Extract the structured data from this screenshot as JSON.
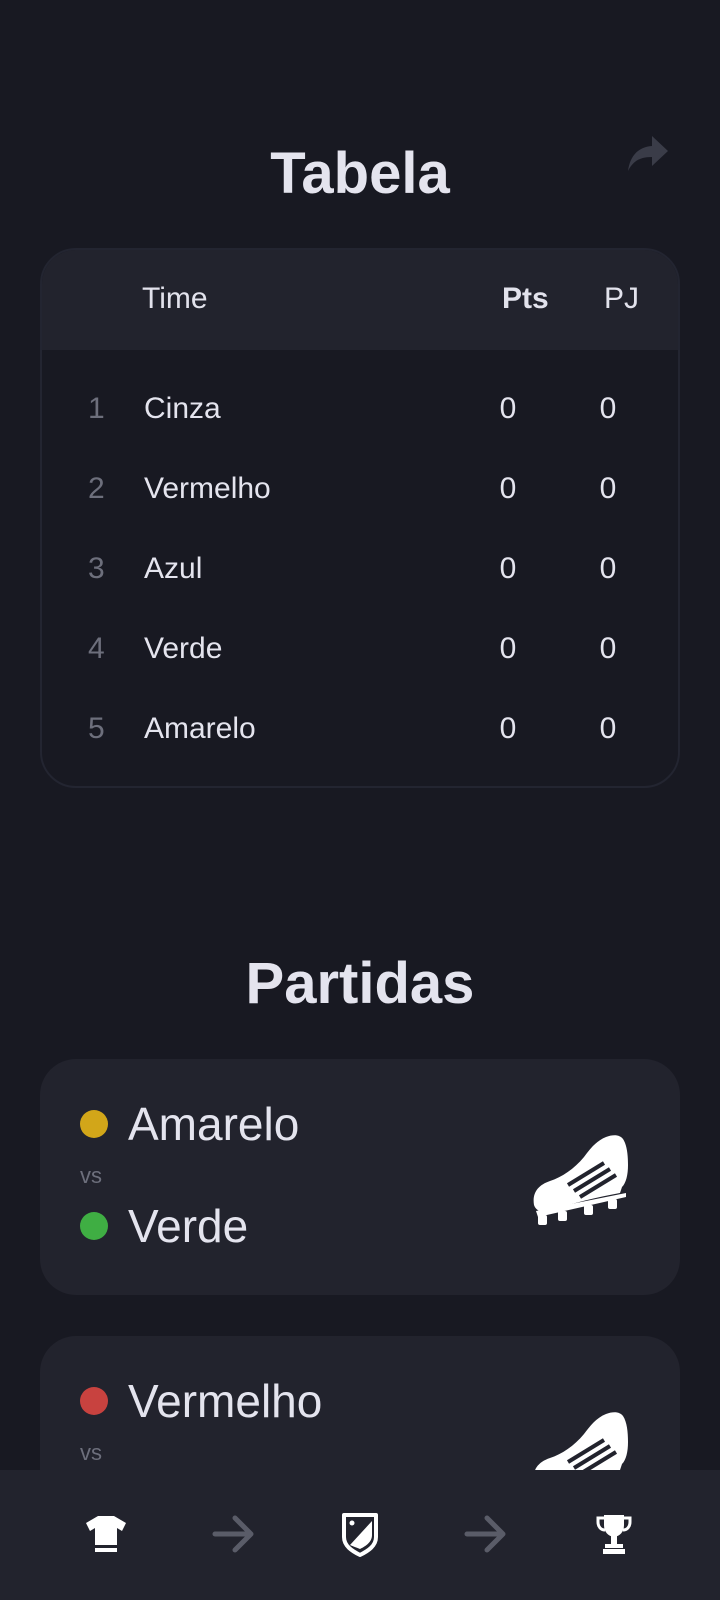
{
  "standings": {
    "title": "Tabela",
    "headers": {
      "team": "Time",
      "points": "Pts",
      "played": "PJ"
    },
    "rows": [
      {
        "pos": "1",
        "team": "Cinza",
        "points": "0",
        "played": "0"
      },
      {
        "pos": "2",
        "team": "Vermelho",
        "points": "0",
        "played": "0"
      },
      {
        "pos": "3",
        "team": "Azul",
        "points": "0",
        "played": "0"
      },
      {
        "pos": "4",
        "team": "Verde",
        "points": "0",
        "played": "0"
      },
      {
        "pos": "5",
        "team": "Amarelo",
        "points": "0",
        "played": "0"
      }
    ]
  },
  "matches": {
    "title": "Partidas",
    "vs_label": "vs",
    "items": [
      {
        "home": {
          "name": "Amarelo",
          "color": "#d2a619"
        },
        "away": {
          "name": "Verde",
          "color": "#3fae43"
        },
        "icon": "soccer-boot-icon"
      },
      {
        "home": {
          "name": "Vermelho",
          "color": "#c8423f"
        },
        "icon": "soccer-boot-icon"
      }
    ]
  },
  "nav": {
    "items": [
      {
        "icon": "jersey-icon"
      },
      {
        "icon": "arrow-right-icon"
      },
      {
        "icon": "shield-badge-icon"
      },
      {
        "icon": "arrow-right-icon"
      },
      {
        "icon": "trophy-icon"
      }
    ]
  },
  "colors": {
    "background": "#181922",
    "card": "#22232d",
    "text": "#e4e4ee",
    "muted": "#6d6f7c"
  }
}
